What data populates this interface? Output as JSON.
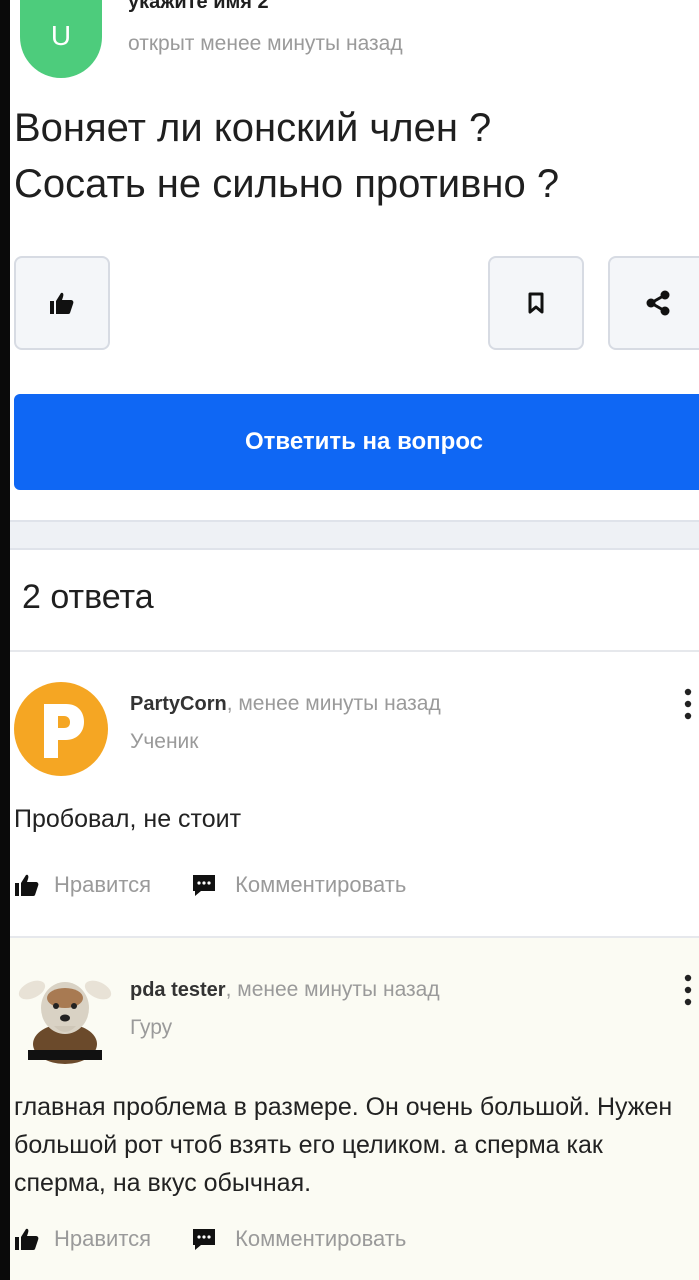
{
  "question": {
    "avatar_letter": "U",
    "author": "укажите имя 2",
    "time": "открыт менее минуты назад",
    "lines": [
      "Воняет ли конский член ?",
      "Сосать не сильно противно ?"
    ],
    "answer_button": "Ответить на вопрос"
  },
  "answers_count": "2 ответа",
  "answers": [
    {
      "name": "PartyCorn",
      "time": ", менее минуты назад",
      "rank": "Ученик",
      "text": "Пробовал, не стоит",
      "like_label": "Нравится",
      "comment_label": "Комментировать",
      "avatar_letter": "P"
    },
    {
      "name": "pda tester",
      "time": ", менее минуты назад",
      "rank": "Гуру",
      "text": "главная проблема в размере. Он очень большой. Нужен большой рот чтоб взять его целиком. а сперма как сперма, на вкус обычная.",
      "like_label": "Нравится",
      "comment_label": "Комментировать"
    }
  ],
  "colors": {
    "primary": "#0f67f4",
    "avatar_green": "#4dcc7c",
    "avatar_orange": "#f5a623",
    "muted": "#9a9a9a"
  },
  "icons": [
    "thumbs-up-icon",
    "bookmark-icon",
    "share-icon",
    "comment-icon",
    "more-vertical-icon"
  ]
}
